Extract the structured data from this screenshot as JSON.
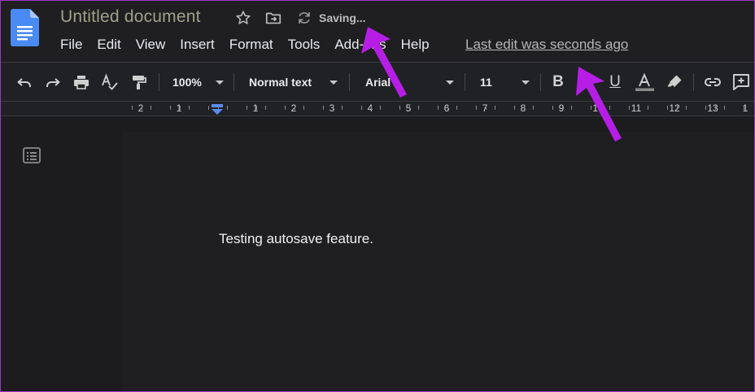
{
  "header": {
    "title": "Untitled document",
    "saving_text": "Saving...",
    "menu": [
      "File",
      "Edit",
      "View",
      "Insert",
      "Format",
      "Tools",
      "Add-ons",
      "Help"
    ],
    "last_edit": "Last edit was seconds ago"
  },
  "toolbar": {
    "zoom": "100%",
    "style": "Normal text",
    "font": "Arial",
    "font_size": "11",
    "bold_label": "B",
    "underline_label": "U",
    "text_color_label": "A"
  },
  "ruler": {
    "numbers": [
      "2",
      "1",
      "1",
      "2",
      "3",
      "4",
      "5",
      "6",
      "7",
      "8",
      "9",
      "10",
      "11",
      "12",
      "13",
      "1"
    ]
  },
  "document": {
    "body_text": "Testing autosave feature."
  },
  "colors": {
    "annotation_arrow": "#b61ee6",
    "doc_icon_blue": "#4a8af4",
    "ruler_marker": "#5b8cf0"
  },
  "icons": [
    "docs-logo",
    "star-icon",
    "move-to-folder-icon",
    "sync-icon",
    "undo-icon",
    "redo-icon",
    "print-icon",
    "spellcheck-icon",
    "paint-format-icon",
    "text-color-icon",
    "highlighter-icon",
    "link-icon",
    "add-comment-icon",
    "outline-icon"
  ]
}
